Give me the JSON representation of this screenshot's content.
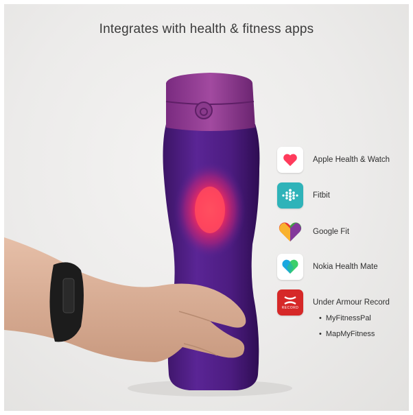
{
  "headline": "Integrates with health & fitness apps",
  "apps": [
    {
      "name": "Apple Health & Watch",
      "icon": "apple-health-heart-icon"
    },
    {
      "name": "Fitbit",
      "icon": "fitbit-dots-icon"
    },
    {
      "name": "Google Fit",
      "icon": "google-fit-heart-icon"
    },
    {
      "name": "Nokia Health Mate",
      "icon": "nokia-health-mate-heart-icon"
    },
    {
      "name": "Under Armour Record",
      "icon": "under-armour-record-icon",
      "icon_text": "RECORD"
    }
  ],
  "sub_items": [
    "MyFitnessPal",
    "MapMyFitness"
  ],
  "bullet": "•",
  "colors": {
    "bottle_purple": "#4a1a7a",
    "cap_purple": "#8a3a8c",
    "glow": "#ff3b5c",
    "band_black": "#1c1c1c",
    "skin": "#dcb29a",
    "fitbit_teal": "#2fb3b9",
    "ua_red": "#d62828"
  }
}
